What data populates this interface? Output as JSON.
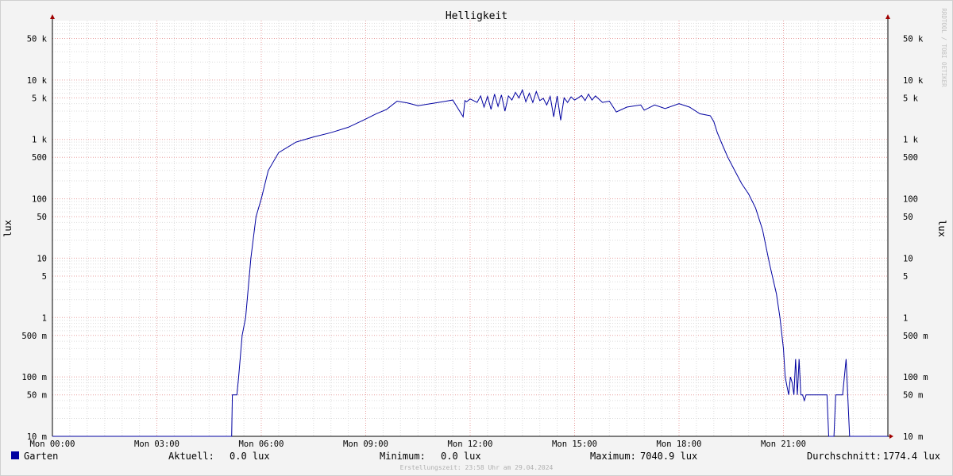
{
  "chart_data": {
    "type": "line",
    "title": "Helligkeit",
    "ylabel": "lux",
    "ylabel_right": "lux",
    "yscale": "log",
    "ylim": [
      0.01,
      100000
    ],
    "watermark": "RRDTOOL / TOBI OETIKER",
    "y_ticks": [
      {
        "v": 50000,
        "label": "50 k"
      },
      {
        "v": 10000,
        "label": "10 k"
      },
      {
        "v": 5000,
        "label": "5 k"
      },
      {
        "v": 1000,
        "label": "1 k"
      },
      {
        "v": 500,
        "label": "500"
      },
      {
        "v": 100,
        "label": "100"
      },
      {
        "v": 50,
        "label": "50"
      },
      {
        "v": 10,
        "label": "10"
      },
      {
        "v": 5,
        "label": "5"
      },
      {
        "v": 1,
        "label": "1"
      },
      {
        "v": 0.5,
        "label": "500 m"
      },
      {
        "v": 0.1,
        "label": "100 m"
      },
      {
        "v": 0.05,
        "label": "50 m"
      },
      {
        "v": 0.01,
        "label": "10 m"
      }
    ],
    "x_ticks": [
      {
        "h": 0,
        "label": "Mon 00:00"
      },
      {
        "h": 3,
        "label": "Mon 03:00"
      },
      {
        "h": 6,
        "label": "Mon 06:00"
      },
      {
        "h": 9,
        "label": "Mon 09:00"
      },
      {
        "h": 12,
        "label": "Mon 12:00"
      },
      {
        "h": 15,
        "label": "Mon 15:00"
      },
      {
        "h": 18,
        "label": "Mon 18:00"
      },
      {
        "h": 21,
        "label": "Mon 21:00"
      }
    ],
    "series": [
      {
        "name": "Garten",
        "color": "#0000a0",
        "x_hours": [
          0,
          5.15,
          5.17,
          5.3,
          5.35,
          5.45,
          5.55,
          5.7,
          5.85,
          6.0,
          6.2,
          6.5,
          7.0,
          7.5,
          8.0,
          8.5,
          9.0,
          9.3,
          9.6,
          9.9,
          10.2,
          10.5,
          11.0,
          11.5,
          11.8,
          11.85,
          11.9,
          12.0,
          12.2,
          12.3,
          12.4,
          12.5,
          12.6,
          12.7,
          12.8,
          12.9,
          13.0,
          13.1,
          13.2,
          13.3,
          13.4,
          13.5,
          13.6,
          13.7,
          13.8,
          13.9,
          14.0,
          14.1,
          14.2,
          14.3,
          14.4,
          14.5,
          14.6,
          14.7,
          14.8,
          14.9,
          15.0,
          15.1,
          15.2,
          15.3,
          15.4,
          15.5,
          15.6,
          15.8,
          16.0,
          16.2,
          16.5,
          16.9,
          17.0,
          17.3,
          17.6,
          18.0,
          18.3,
          18.6,
          18.9,
          19.0,
          19.1,
          19.25,
          19.4,
          19.6,
          19.8,
          20.0,
          20.2,
          20.4,
          20.6,
          20.8,
          20.9,
          21.0,
          21.05,
          21.1,
          21.15,
          21.2,
          21.25,
          21.3,
          21.35,
          21.4,
          21.45,
          21.5,
          21.55,
          21.6,
          21.65,
          21.7,
          21.75,
          21.8,
          21.85,
          21.9,
          21.95,
          22.0,
          22.05,
          22.1,
          22.15,
          22.2,
          22.25,
          22.3,
          22.35,
          22.4,
          22.45,
          22.5,
          22.55,
          22.6,
          22.7,
          22.8,
          22.9,
          23.0,
          23.1,
          23.2,
          23.3,
          23.5,
          23.7,
          23.9,
          24.0
        ],
        "values": [
          0.01,
          0.01,
          0.05,
          0.05,
          0.1,
          0.5,
          1,
          10,
          50,
          100,
          300,
          600,
          900,
          1100,
          1300,
          1600,
          2200,
          2700,
          3200,
          4400,
          4100,
          3700,
          4100,
          4600,
          2400,
          4500,
          4300,
          4800,
          4200,
          5400,
          3500,
          5300,
          3200,
          5800,
          3600,
          5600,
          3000,
          5400,
          4600,
          6200,
          5000,
          6800,
          4300,
          6000,
          4200,
          6400,
          4500,
          4900,
          3800,
          5300,
          2400,
          5400,
          2100,
          5000,
          4200,
          5200,
          4600,
          5000,
          5500,
          4500,
          5800,
          4600,
          5400,
          4200,
          4400,
          2900,
          3500,
          3800,
          3100,
          3800,
          3300,
          4000,
          3500,
          2700,
          2500,
          2000,
          1300,
          800,
          500,
          300,
          180,
          120,
          70,
          30,
          8,
          2.5,
          1,
          0.3,
          0.1,
          0.07,
          0.05,
          0.1,
          0.08,
          0.05,
          0.2,
          0.05,
          0.2,
          0.05,
          0.05,
          0.04,
          0.05,
          0.05,
          0.05,
          0.05,
          0.05,
          0.05,
          0.05,
          0.05,
          0.05,
          0.05,
          0.05,
          0.05,
          0.05,
          0.01,
          0.01,
          0.01,
          0.01,
          0.05,
          0.05,
          0.05,
          0.05,
          0.2,
          0.01,
          0.01,
          0.01,
          0.01,
          0.01,
          0.01,
          0.01,
          0.01,
          0.01,
          0.01,
          0.01
        ]
      }
    ]
  },
  "legend": {
    "series_name": "Garten",
    "series_color": "#0000a0",
    "aktuell_label": "Aktuell:",
    "aktuell_value": "0.0 lux",
    "minimum_label": "Minimum:",
    "minimum_value": "0.0 lux",
    "maximum_label": "Maximum:",
    "maximum_value": "7040.9 lux",
    "durchschnitt_label": "Durchschnitt:",
    "durchschnitt_value": "1774.4 lux"
  },
  "footer": {
    "creation_time": "Erstellungszeit: 23:58 Uhr am 29.04.2024"
  }
}
